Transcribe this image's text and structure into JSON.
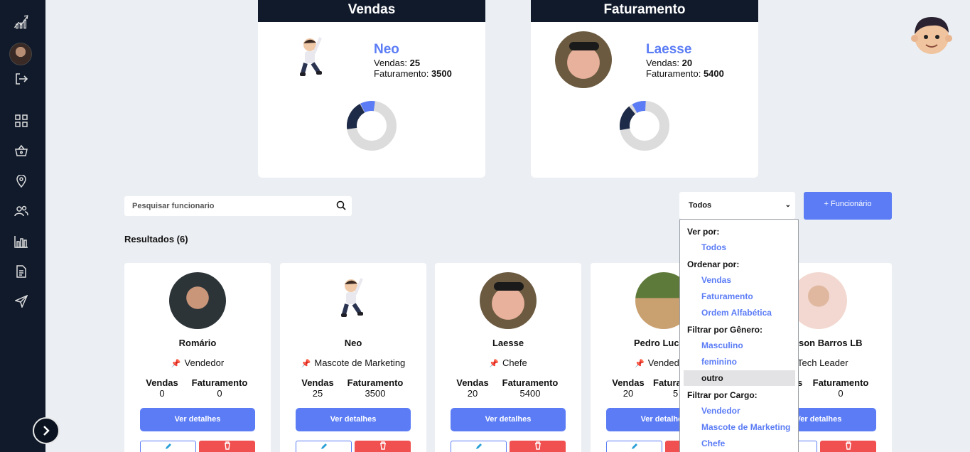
{
  "sidebar": {
    "icons": [
      "analytics-logo-icon",
      "user-avatar",
      "logout-icon",
      "dashboard-icon",
      "basket-icon",
      "location-icon",
      "users-icon",
      "chart-bar-icon",
      "document-icon",
      "send-icon"
    ]
  },
  "top_cards": [
    {
      "title": "Vendas",
      "name": "Neo",
      "vendas_label": "Vendas:",
      "vendas": "25",
      "fat_label": "Faturamento:",
      "faturamento": "3500"
    },
    {
      "title": "Faturamento",
      "name": "Laesse",
      "vendas_label": "Vendas:",
      "vendas": "20",
      "fat_label": "Faturamento:",
      "faturamento": "5400"
    }
  ],
  "search": {
    "placeholder": "Pesquisar funcionario"
  },
  "filter": {
    "selected": "Todos"
  },
  "add_button": "+ Funcionário",
  "results_label": "Resultados (6)",
  "stat_labels": {
    "vendas": "Vendas",
    "faturamento": "Faturamento"
  },
  "details_label": "Ver detalhes",
  "employees": [
    {
      "name": "Romário",
      "role": "Vendedor",
      "vendas": "0",
      "faturamento": "0"
    },
    {
      "name": "Neo",
      "role": "Mascote de Marketing",
      "vendas": "25",
      "faturamento": "3500"
    },
    {
      "name": "Laesse",
      "role": "Chefe",
      "vendas": "20",
      "faturamento": "5400"
    },
    {
      "name": "Pedro Luc",
      "role": "Vended",
      "vendas": "20",
      "faturamento": "5"
    },
    {
      "name": "son Barros LB",
      "role": "Tech Leader",
      "vendas": "s",
      "faturamento": "0"
    }
  ],
  "dropdown": {
    "groups": [
      "Ver por:",
      "Ordenar por:",
      "Filtrar por Gênero:",
      "Filtrar por Cargo:"
    ],
    "ver_por": [
      "Todos"
    ],
    "ordenar_por": [
      "Vendas",
      "Faturamento",
      "Ordem Alfabética"
    ],
    "genero": [
      "Masculino",
      "feminino",
      "outro"
    ],
    "cargo": [
      "Vendedor",
      "Mascote de Marketing",
      "Chefe"
    ]
  },
  "donut_colors": {
    "series_a": "#1e2b48",
    "series_b": "#5b7cf5",
    "rest": "#dcdcdc"
  },
  "accent": "#5b7cf5",
  "danger": "#f05050"
}
